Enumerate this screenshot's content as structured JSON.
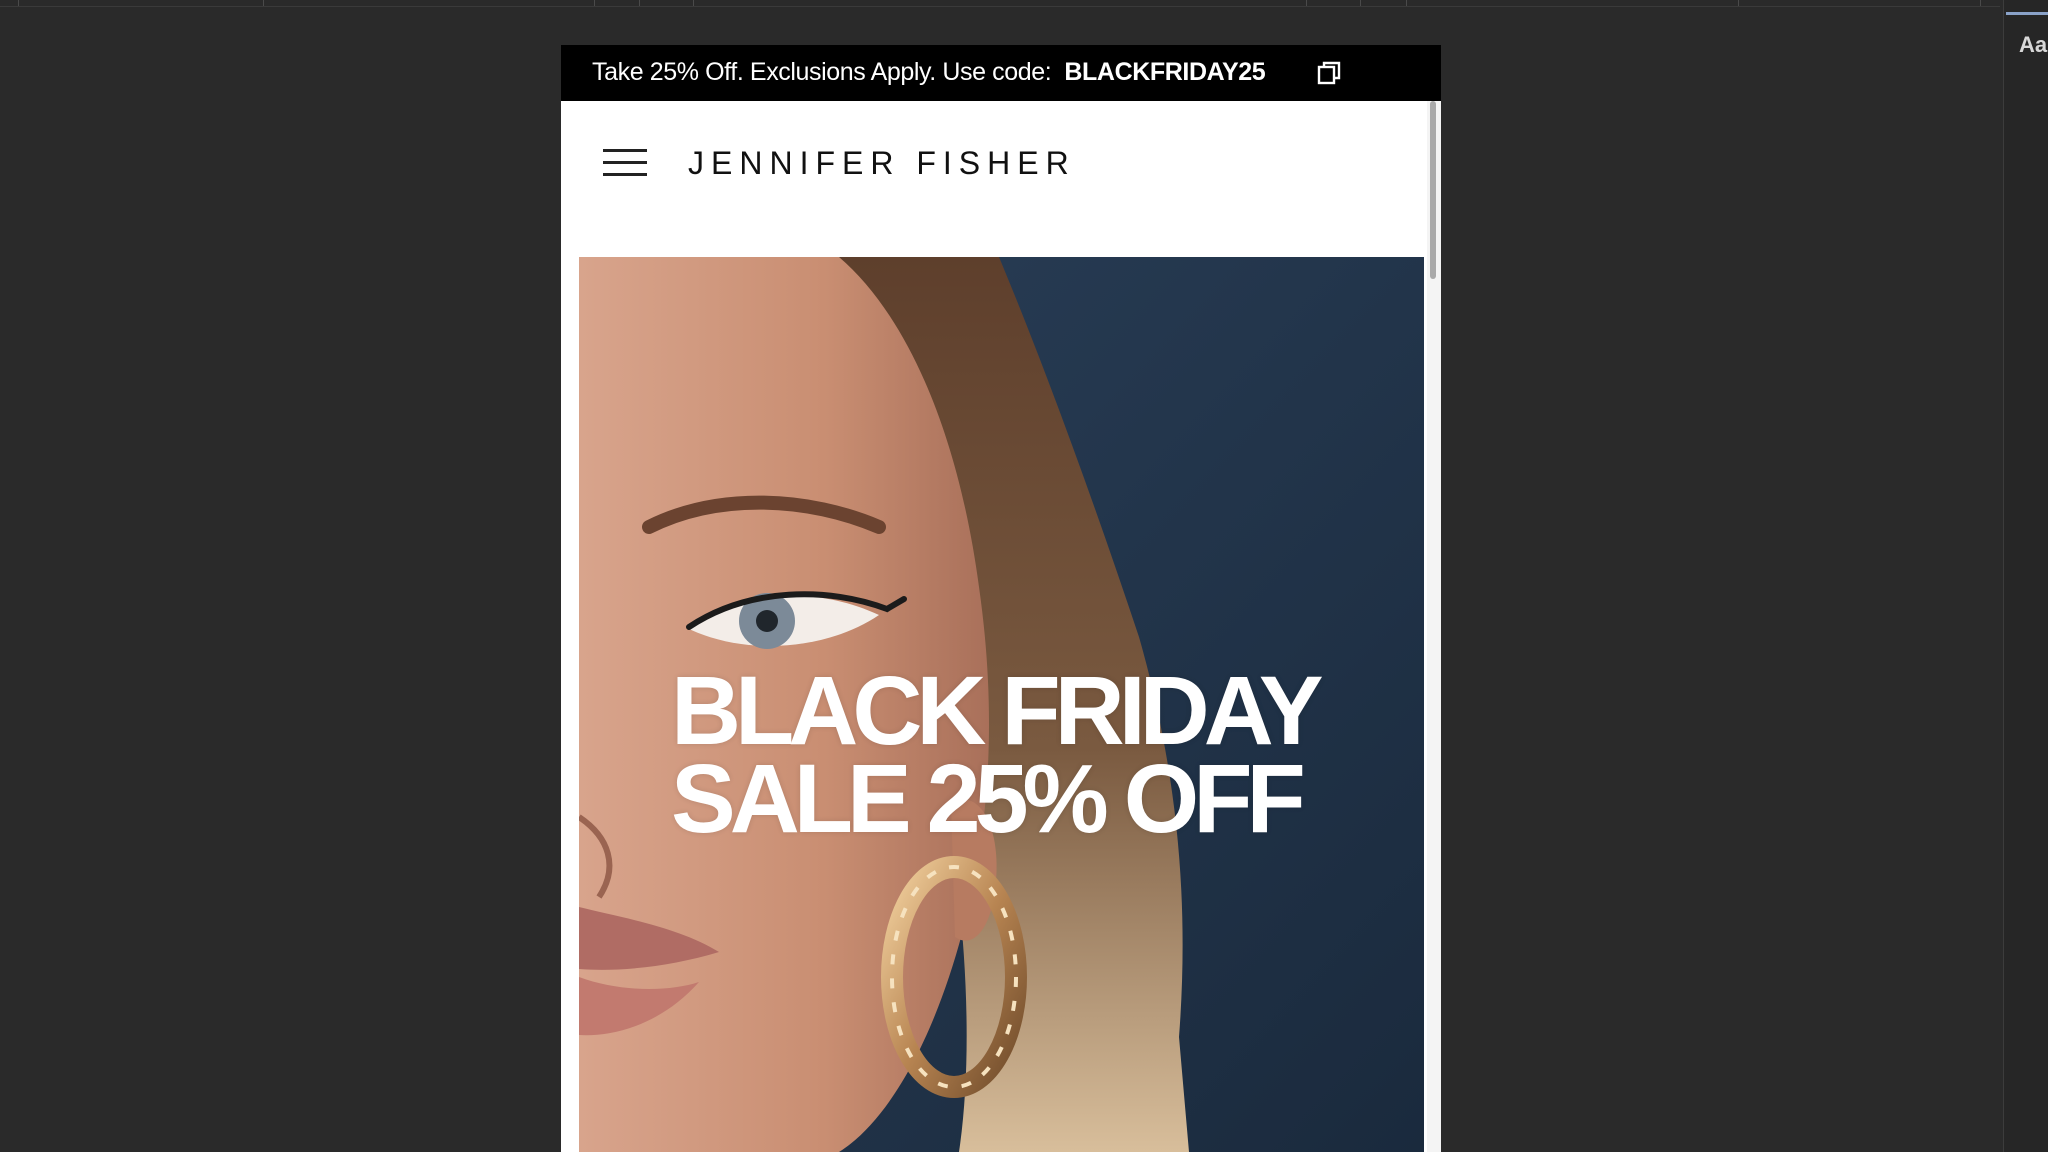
{
  "devtools": {
    "side_label": "Aa"
  },
  "promo": {
    "text": "Take 25% Off. Exclusions Apply. Use code:",
    "code": "BLACKFRIDAY25",
    "copy_icon": "copy-icon"
  },
  "header": {
    "menu_icon": "hamburger-menu-icon",
    "logo": "JENNIFER FISHER"
  },
  "hero": {
    "line1": "BLACK FRIDAY",
    "line2": "SALE 25% OFF"
  },
  "colors": {
    "promo_bg": "#000000",
    "hero_bg": "#21344a",
    "page_bg": "#2a2a2a"
  }
}
